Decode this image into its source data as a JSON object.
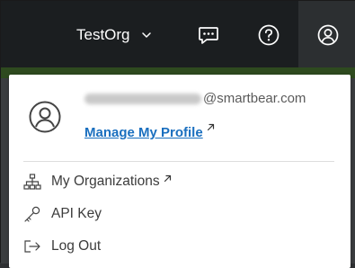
{
  "header": {
    "org_name": "TestOrg",
    "icons": {
      "org_chevron": "chevron-down-icon",
      "chat": "chat-bubble-icon",
      "help": "help-circle-icon",
      "profile": "user-circle-icon"
    }
  },
  "profile_menu": {
    "email_domain": "@smartbear.com",
    "manage_profile_label": "Manage My Profile",
    "items": [
      {
        "label": "My Organizations",
        "icon": "org-chart-icon",
        "external": true
      },
      {
        "label": "API Key",
        "icon": "key-icon",
        "external": false
      },
      {
        "label": "Log Out",
        "icon": "log-out-icon",
        "external": false
      }
    ]
  },
  "colors": {
    "topbar": "#1b1e20",
    "accent_strip": "#2e4a1f",
    "link": "#1a6fbf",
    "text": "#3c3c3c"
  }
}
